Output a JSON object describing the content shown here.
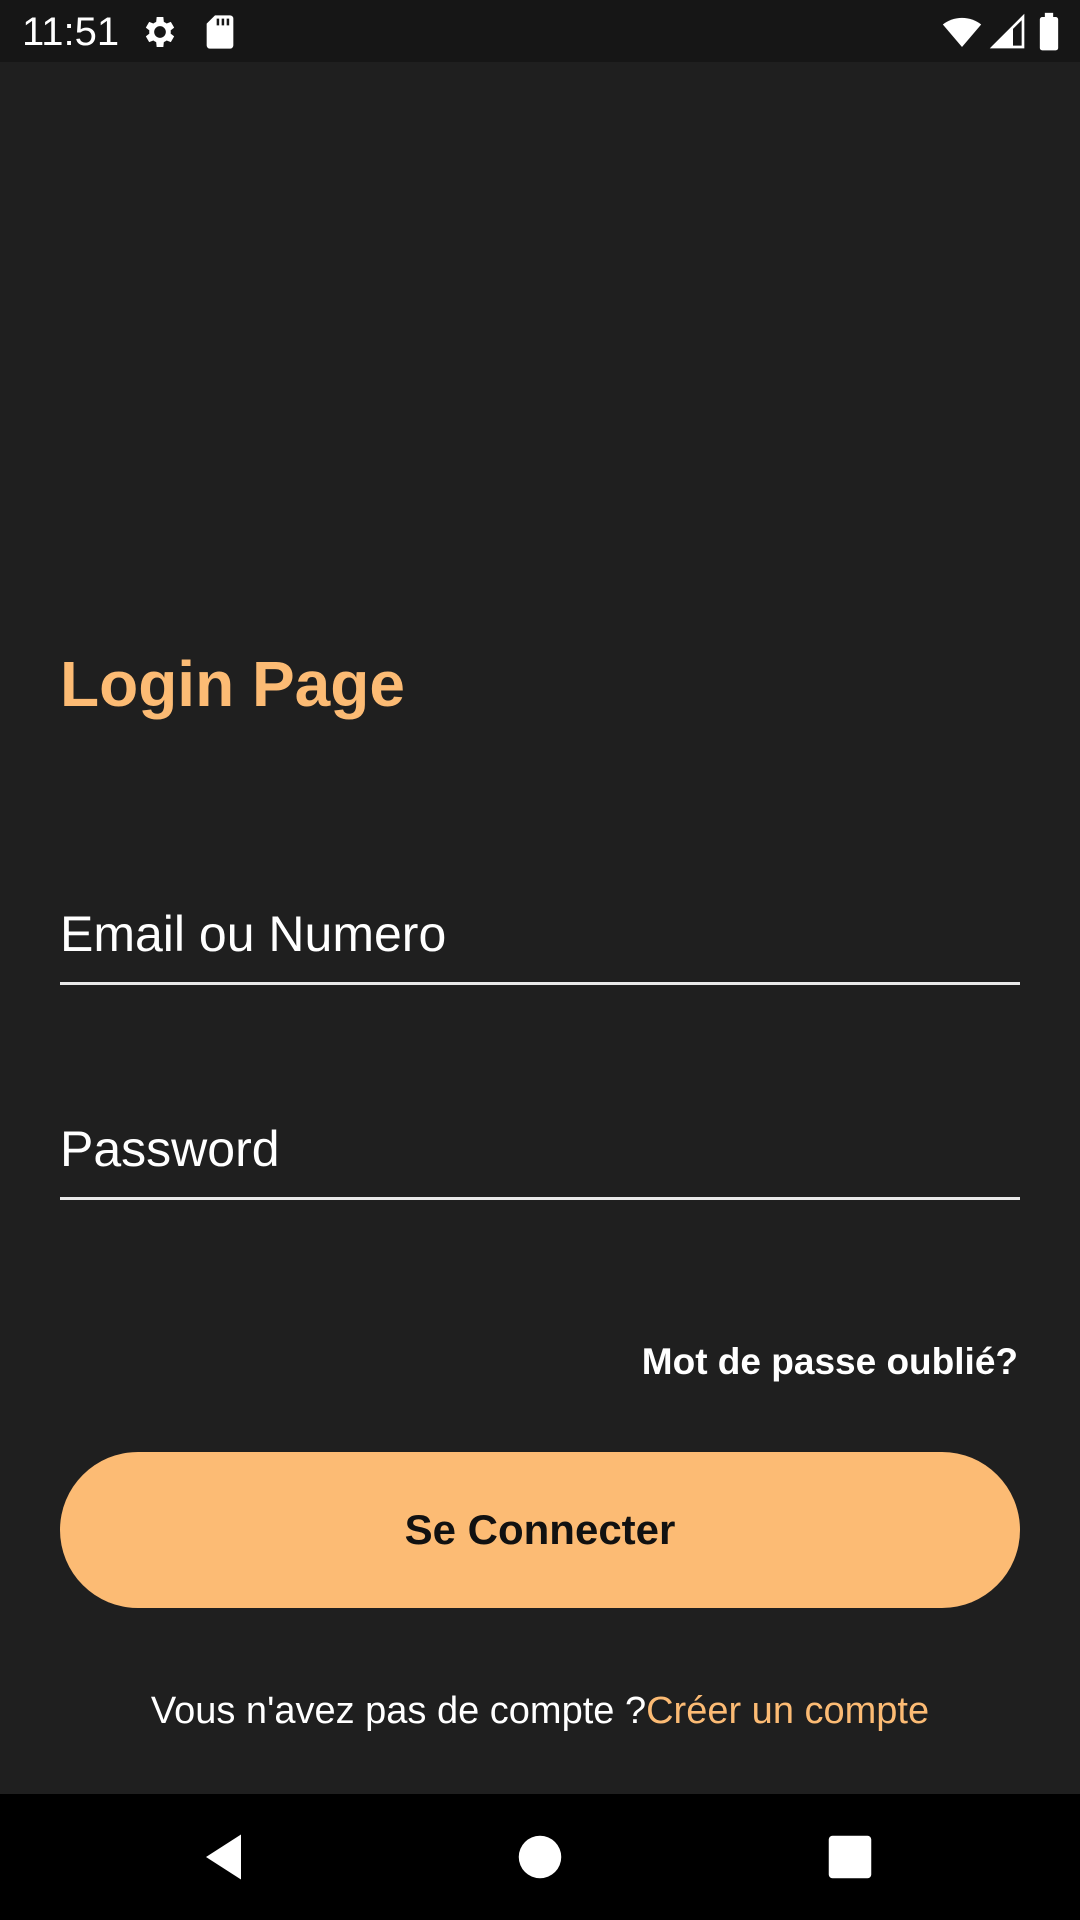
{
  "status_bar": {
    "time": "11:51",
    "icons": [
      "gear-icon",
      "sd-card-icon",
      "wifi-icon",
      "cell-signal-icon",
      "battery-icon"
    ]
  },
  "login": {
    "title": "Login Page",
    "email_placeholder": "Email ou Numero",
    "email_value": "",
    "password_placeholder": "Password",
    "password_value": "",
    "forgot_label": "Mot de passe oublié?",
    "submit_label": "Se Connecter",
    "signup_prompt": "Vous n'avez pas de compte ?",
    "signup_link": "Créer un compte"
  },
  "nav_bar": {
    "buttons": [
      "back-icon",
      "home-icon",
      "recents-icon"
    ]
  },
  "colors": {
    "accent": "#fcbb74",
    "background": "#1f1f1f",
    "status_bar": "#161616",
    "nav_bar": "#000000",
    "text": "#ffffff"
  }
}
